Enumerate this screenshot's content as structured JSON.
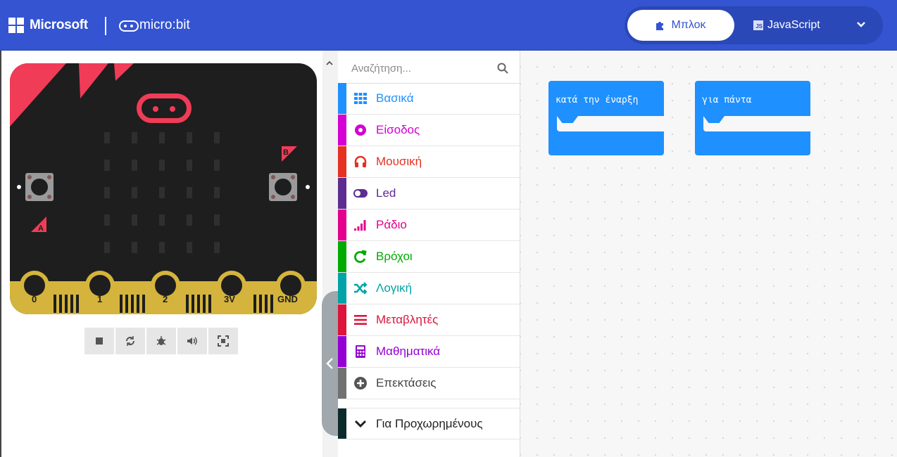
{
  "header": {
    "brand": "Microsoft",
    "product": "micro:bit",
    "mode_blocks": "Μπλοκ",
    "mode_js": "JavaScript",
    "js_badge": "JS"
  },
  "simulator": {
    "pins": [
      "0",
      "1",
      "2",
      "3V",
      "GND"
    ],
    "button_a": "A",
    "button_b": "B",
    "toolbar": [
      "stop-icon",
      "restart-icon",
      "debug-icon",
      "mute-icon",
      "fullscreen-icon"
    ]
  },
  "toolbox": {
    "search_placeholder": "Αναζήτηση...",
    "categories": [
      {
        "label": "Βασικά",
        "color": "#1e90ff"
      },
      {
        "label": "Είσοδος",
        "color": "#d400d4"
      },
      {
        "label": "Μουσική",
        "color": "#e63022"
      },
      {
        "label": "Led",
        "color": "#5c2d91"
      },
      {
        "label": "Ράδιο",
        "color": "#e3008c"
      },
      {
        "label": "Βρόχοι",
        "color": "#00aa00"
      },
      {
        "label": "Λογική",
        "color": "#00a4a6"
      },
      {
        "label": "Μεταβλητές",
        "color": "#dc143c"
      },
      {
        "label": "Μαθηματικά",
        "color": "#9400d3"
      },
      {
        "label": "Επεκτάσεις",
        "color": "#717171"
      }
    ],
    "advanced": "Για Προχωρημένους"
  },
  "workspace": {
    "blocks": [
      {
        "label": "κατά την έναρξη"
      },
      {
        "label": "για πάντα"
      }
    ]
  },
  "colors": {
    "header": "#3454d1",
    "accent": "#3454d1",
    "block": "#1e90ff"
  }
}
